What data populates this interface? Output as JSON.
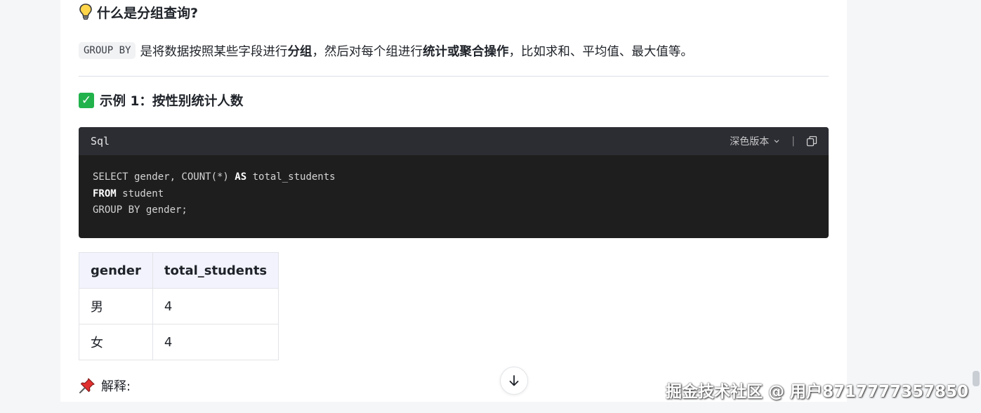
{
  "section1": {
    "title": "什么是分组查询?"
  },
  "paragraph": {
    "code": "GROUP BY",
    "t1": "是将数据按照某些字段进行",
    "b1": "分组",
    "t2": "，然后对每个组进行",
    "b2": "统计或聚合操作",
    "t3": "，比如求和、平均值、最大值等。"
  },
  "section2": {
    "title": "示例 1：按性别统计人数"
  },
  "codeblock": {
    "language": "Sql",
    "theme_label": "深色版本",
    "lines": [
      {
        "kw": "",
        "rest": "SELECT gender, COUNT(*) ",
        "kw2": "AS",
        "rest2": " total_students"
      },
      {
        "kw": "FROM",
        "rest": " student",
        "kw2": "",
        "rest2": ""
      },
      {
        "kw": "",
        "rest": "GROUP BY gender;",
        "kw2": "",
        "rest2": ""
      }
    ]
  },
  "table": {
    "headers": [
      "gender",
      "total_students"
    ],
    "rows": [
      [
        "男",
        "4"
      ],
      [
        "女",
        "4"
      ]
    ]
  },
  "section3": {
    "title": "解释:"
  },
  "watermark": "掘金技术社区 @ 用户8717777357850",
  "colors": {
    "code_bg": "#1e1e1e",
    "code_header_bg": "#2c2d33",
    "table_header_bg": "#f2f3fd",
    "check_green": "#22b24c"
  }
}
